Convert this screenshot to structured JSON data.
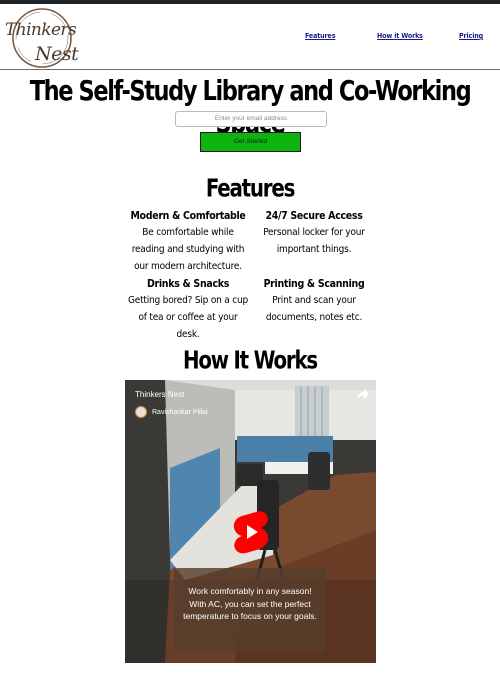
{
  "brand": {
    "logo_line1": "Thinkers",
    "logo_line2": "Nest"
  },
  "nav": {
    "features": "Features",
    "how_it_works": "How it Works",
    "pricing": "Pricing"
  },
  "hero": {
    "headline": "The Self-Study Library and Co-Working Space",
    "email_placeholder": "Enter your email address",
    "cta": "Get Started"
  },
  "features": {
    "title": "Features",
    "items": [
      {
        "title": "Modern & Comfortable",
        "desc": "Be comfortable while reading and studying with our modern architecture."
      },
      {
        "title": "24/7 Secure Access",
        "desc": "Personal locker for your important things."
      },
      {
        "title": "Drinks & Snacks",
        "desc": "Getting bored? Sip on a cup of tea or coffee at your desk."
      },
      {
        "title": "Printing & Scanning",
        "desc": "Print and scan your documents, notes etc."
      }
    ]
  },
  "how": {
    "title": "How It Works",
    "video": {
      "title": "Thinkers Nest",
      "channel": "Ravishankar Pillai",
      "caption": "Work comfortably in any season! With AC, you can set the perfect temperature to focus on your goals."
    }
  },
  "colors": {
    "cta": "#0db40d",
    "nav_link": "#1a1a8c",
    "logo": "#5a4636",
    "play_red": "#ff0000"
  },
  "icons": {
    "share": "share-arrow-icon",
    "play": "youtube-shorts-play-icon"
  }
}
